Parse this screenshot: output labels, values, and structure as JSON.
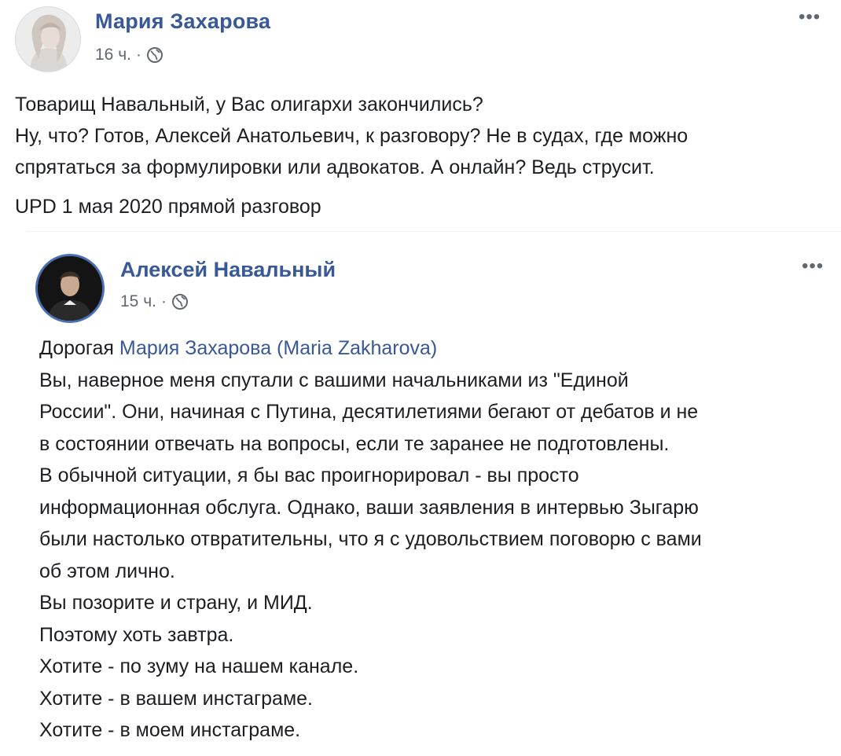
{
  "post": {
    "author": "Мария Захарова",
    "time": "16 ч.",
    "separator": "·",
    "more": "•••",
    "text_lines": [
      "Товарищ Навальный, у Вас олигархи закончились?",
      "Ну, что? Готов, Алексей Анатольевич, к разговору? Не в судах, где можно",
      "спрятаться за формулировки или адвокатов. А онлайн? Ведь струсит."
    ],
    "update": "UPD 1 мая 2020 прямой разговор"
  },
  "shared_post": {
    "author": "Алексей Навальный",
    "time": "15 ч.",
    "separator": "·",
    "more": "•••",
    "greeting_prefix": "Дорогая ",
    "mention": "Мария Захарова (Maria Zakharova)",
    "text_lines": [
      "Вы, наверное меня спутали с вашими начальниками из \"Единой",
      "России\". Они, начиная с Путина, десятилетиями бегают от дебатов и не",
      "в состоянии отвечать на вопросы, если те заранее не подготовлены.",
      "В обычной ситуации, я бы вас проигнорировал - вы просто",
      "информационная обслуга. Однако, ваши заявления в интервью Зыгарю",
      "были настолько отвратительны, что я с удовольствием поговорю с вами",
      "об этом лично.",
      "Вы позорите и страну, и МИД.",
      "Поэтому хоть завтра.",
      "Хотите - по зуму на нашем канале.",
      "Хотите - в вашем инстаграме.",
      "Хотите - в моем инстаграме."
    ]
  },
  "colors": {
    "name": "#385898",
    "meta": "#616770",
    "text": "#1c1e21"
  },
  "icons": {
    "privacy": "globe-icon",
    "options": "more-options-icon"
  }
}
